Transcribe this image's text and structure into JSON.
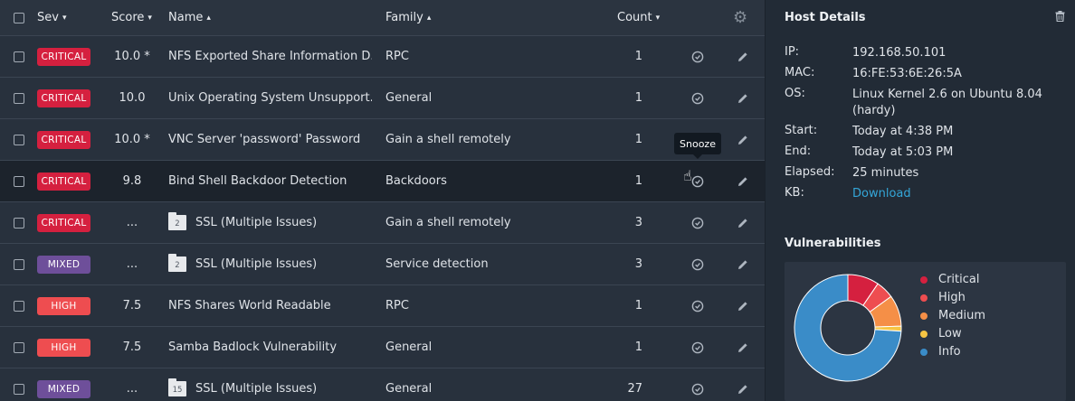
{
  "table": {
    "columns": {
      "sev": "Sev",
      "sev_sort": "▾",
      "score": "Score",
      "score_sort": "▾",
      "name": "Name",
      "name_sort": "▴",
      "family": "Family",
      "family_sort": "▴",
      "count": "Count",
      "count_sort": "▾"
    },
    "settings_icon": "gear-icon",
    "rows": [
      {
        "severity": "CRITICAL",
        "sev_color": "#d5203f",
        "score": "10.0 *",
        "name": "NFS Exported Share Information D...",
        "family": "RPC",
        "count": "1"
      },
      {
        "severity": "CRITICAL",
        "sev_color": "#d5203f",
        "score": "10.0",
        "name": "Unix Operating System Unsupport...",
        "family": "General",
        "count": "1"
      },
      {
        "severity": "CRITICAL",
        "sev_color": "#d5203f",
        "score": "10.0 *",
        "name": "VNC Server 'password' Password",
        "family": "Gain a shell remotely",
        "count": "1"
      },
      {
        "severity": "CRITICAL",
        "sev_color": "#d5203f",
        "score": "9.8",
        "name": "Bind Shell Backdoor Detection",
        "family": "Backdoors",
        "count": "1"
      },
      {
        "severity": "CRITICAL",
        "sev_color": "#d5203f",
        "score": "...",
        "group_count": "2",
        "name": "SSL (Multiple Issues)",
        "family": "Gain a shell remotely",
        "count": "3"
      },
      {
        "severity": "MIXED",
        "sev_color": "#6e4f9a",
        "score": "...",
        "group_count": "2",
        "name": "SSL (Multiple Issues)",
        "family": "Service detection",
        "count": "3"
      },
      {
        "severity": "HIGH",
        "sev_color": "#ee4d50",
        "score": "7.5",
        "name": "NFS Shares World Readable",
        "family": "RPC",
        "count": "1"
      },
      {
        "severity": "HIGH",
        "sev_color": "#ee4d50",
        "score": "7.5",
        "name": "Samba Badlock Vulnerability",
        "family": "General",
        "count": "1"
      },
      {
        "severity": "MIXED",
        "sev_color": "#6e4f9a",
        "score": "...",
        "group_count": "15",
        "name": "SSL (Multiple Issues)",
        "family": "General",
        "count": "27"
      }
    ],
    "snooze_icon": "snooze-clock-icon",
    "edit_icon": "pencil-icon",
    "tooltip": "Snooze"
  },
  "host_details": {
    "title": "Host Details",
    "delete_icon": "trash-icon",
    "ip_label": "IP:",
    "ip": "192.168.50.101",
    "mac_label": "MAC:",
    "mac": "16:FE:53:6E:26:5A",
    "os_label": "OS:",
    "os": "Linux Kernel 2.6 on Ubuntu 8.04 (hardy)",
    "start_label": "Start:",
    "start": "Today at 4:38 PM",
    "end_label": "End:",
    "end": "Today at 5:03 PM",
    "elapsed_label": "Elapsed:",
    "elapsed": "25 minutes",
    "kb_label": "KB:",
    "kb_link": "Download"
  },
  "vulnerabilities": {
    "title": "Vulnerabilities",
    "legend": [
      {
        "label": "Critical",
        "color": "#d5203f"
      },
      {
        "label": "High",
        "color": "#ee4d50"
      },
      {
        "label": "Medium",
        "color": "#f58f47"
      },
      {
        "label": "Low",
        "color": "#f6c543"
      },
      {
        "label": "Info",
        "color": "#3a8cc8"
      }
    ],
    "chart_data": {
      "type": "pie",
      "categories": [
        "Critical",
        "High",
        "Medium",
        "Low",
        "Info"
      ],
      "values": [
        9.5,
        5.5,
        9.5,
        1.5,
        74
      ],
      "colors": [
        "#d5203f",
        "#ee4d50",
        "#f58f47",
        "#f6c543",
        "#3a8cc8"
      ]
    }
  }
}
